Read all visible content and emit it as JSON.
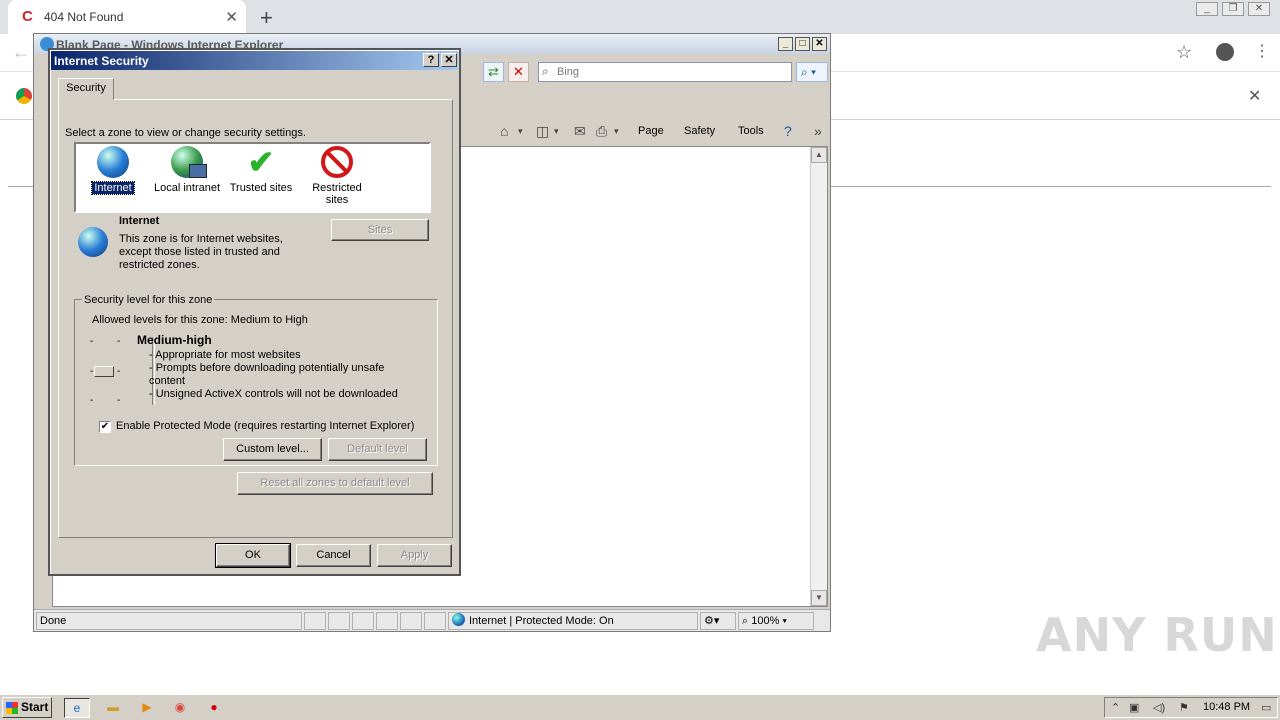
{
  "chrome": {
    "tab_title": "404 Not Found",
    "tab_close": "✕",
    "new_tab": "+"
  },
  "ie": {
    "window_title": "Blank Page - Windows Internet Explorer",
    "search_placeholder": "Bing",
    "commands": [
      "Page",
      "Safety",
      "Tools"
    ],
    "status_text": "Done",
    "zone_status": "Internet | Protected Mode: On",
    "zoom": "100%"
  },
  "dialog": {
    "title": "Internet Security",
    "tab": "Security",
    "zone_prompt": "Select a zone to view or change security settings.",
    "zones": [
      {
        "label": "Internet",
        "selected": true,
        "icon": "globe-icon"
      },
      {
        "label": "Local intranet",
        "selected": false,
        "icon": "intranet-icon"
      },
      {
        "label": "Trusted sites",
        "selected": false,
        "icon": "checkmark-icon"
      },
      {
        "label": "Restricted sites",
        "selected": false,
        "icon": "restricted-icon"
      }
    ],
    "zone_name": "Internet",
    "zone_desc": "This zone is for Internet websites, except those listed in trusted and restricted zones.",
    "sites_button": "Sites",
    "group_label": "Security level for this zone",
    "allowed_levels": "Allowed levels for this zone: Medium to High",
    "level_name": "Medium-high",
    "level_desc": [
      "- Appropriate for most websites",
      "- Prompts before downloading potentially unsafe content",
      "- Unsigned ActiveX controls will not be downloaded"
    ],
    "protected_mode_label": "Enable Protected Mode (requires restarting Internet Explorer)",
    "protected_mode_checked": true,
    "custom_level": "Custom level...",
    "default_level": "Default level",
    "reset_all": "Reset all zones to default level",
    "ok": "OK",
    "cancel": "Cancel",
    "apply": "Apply"
  },
  "taskbar": {
    "start": "Start",
    "clock": "10:48 PM"
  },
  "watermark": "ANY RUN"
}
